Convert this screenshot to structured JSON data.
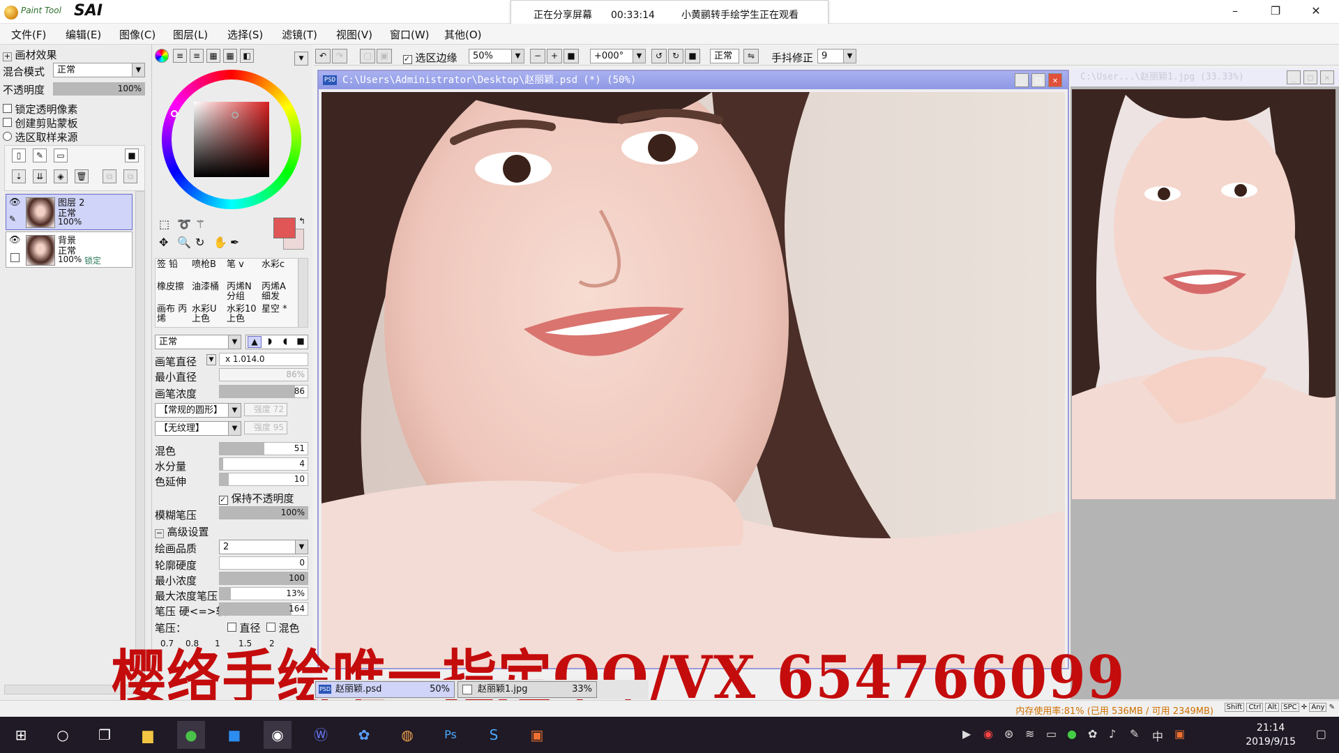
{
  "app": {
    "logo_small": "Paint Tool",
    "logo_big": "SAI",
    "window_controls": [
      "–",
      "❐",
      "✕"
    ]
  },
  "share_banner": {
    "status": "正在分享屏幕",
    "time": "00:33:14",
    "viewers": "小黄鹂转手绘学生正在观看"
  },
  "menu": [
    "文件(F)",
    "编辑(E)",
    "图像(C)",
    "图层(L)",
    "选择(S)",
    "滤镜(T)",
    "视图(V)",
    "窗口(W)",
    "其他(O)"
  ],
  "layer_panel": {
    "effects_label": "画材效果",
    "blend_label": "混合模式",
    "blend_value": "正常",
    "opacity_label": "不透明度",
    "opacity_value": "100%",
    "opacity_level": 1.0,
    "checkboxes": [
      "锁定透明像素",
      "创建剪贴蒙板",
      "选区取样来源"
    ],
    "layers": [
      {
        "name": "图层 2",
        "mode": "正常",
        "opacity": "100%",
        "locked": "",
        "selected": true
      },
      {
        "name": "背景",
        "mode": "正常",
        "opacity": "100%",
        "locked": "锁定",
        "selected": false
      }
    ]
  },
  "tool_panel": {
    "brushes": [
      [
        "签 铅",
        "喷枪B",
        "笔 v",
        "水彩c"
      ],
      [
        "橡皮擦",
        "油漆桶",
        "丙烯N 分组",
        "丙烯A 细发"
      ],
      [
        "画布 丙烯",
        "水彩U 上色",
        "水彩10 上色",
        "星空 *"
      ]
    ],
    "mode_value": "正常",
    "brush_size_label": "画笔直径",
    "brush_size_mult": "x 1.0",
    "brush_size_value": "14.0",
    "min_size_label": "最小直径",
    "min_size_value": "86%",
    "density_label": "画笔浓度",
    "density_value": "86",
    "shape_value": "【常规的圆形】",
    "shape_strength": "强度 72",
    "texture_value": "【无纹理】",
    "texture_strength": "强度 95",
    "blend_label": "混色",
    "blend_value": "51",
    "water_label": "水分量",
    "water_value": "4",
    "stretch_label": "色延伸",
    "stretch_value": "10",
    "keep_opacity_label": "保持不透明度",
    "blur_label": "模糊笔压",
    "blur_value": "100%",
    "advanced_label": "高级设置",
    "quality_label": "绘画品质",
    "quality_value": "2",
    "edge_label": "轮廓硬度",
    "edge_value": "0",
    "min_density_label": "最小浓度",
    "min_density_value": "100",
    "max_density_label": "最大浓度笔压",
    "max_density_value": "13%",
    "pressure_label": "笔压 硬<=>软",
    "pressure_value": "164",
    "pressure2_label": "笔压：",
    "diam_label": "直径",
    "mix_label": "混色",
    "size_presets": [
      "0.7",
      "0.8",
      "1",
      "1.5",
      "2"
    ]
  },
  "toolbar": {
    "selection_edge_label": "选区边缘",
    "zoom_value": "50%",
    "rotation_value": "+000°",
    "mode_value": "正常",
    "stabilizer_label": "手抖修正",
    "stabilizer_value": "9"
  },
  "canvas_window": {
    "title": "C:\\Users\\Administrator\\Desktop\\赵丽颖.psd (*) (50%)"
  },
  "reference_window": {
    "title": "C:\\User...\\赵丽颖1.jpg (33.33%)"
  },
  "watermark": "樱络手绘唯一指定QQ/VX 654766099",
  "doc_tabs": [
    {
      "name": "赵丽颖.psd",
      "zoom": "50%"
    },
    {
      "name": "赵丽颖1.jpg",
      "zoom": "33%"
    }
  ],
  "status": {
    "memory": "内存使用率:81% (已用 536MB / 可用 2349MB)",
    "keys": [
      "Shift",
      "Ctrl",
      "Alt",
      "SPC",
      "Any"
    ]
  },
  "taskbar": {
    "time": "21:14",
    "date": "2019/9/15",
    "ime": "中"
  },
  "colors": {
    "primary": "#e05555",
    "accent": "#8f99e4",
    "watermark": "#c40c0c",
    "memory_text": "#d07000"
  }
}
